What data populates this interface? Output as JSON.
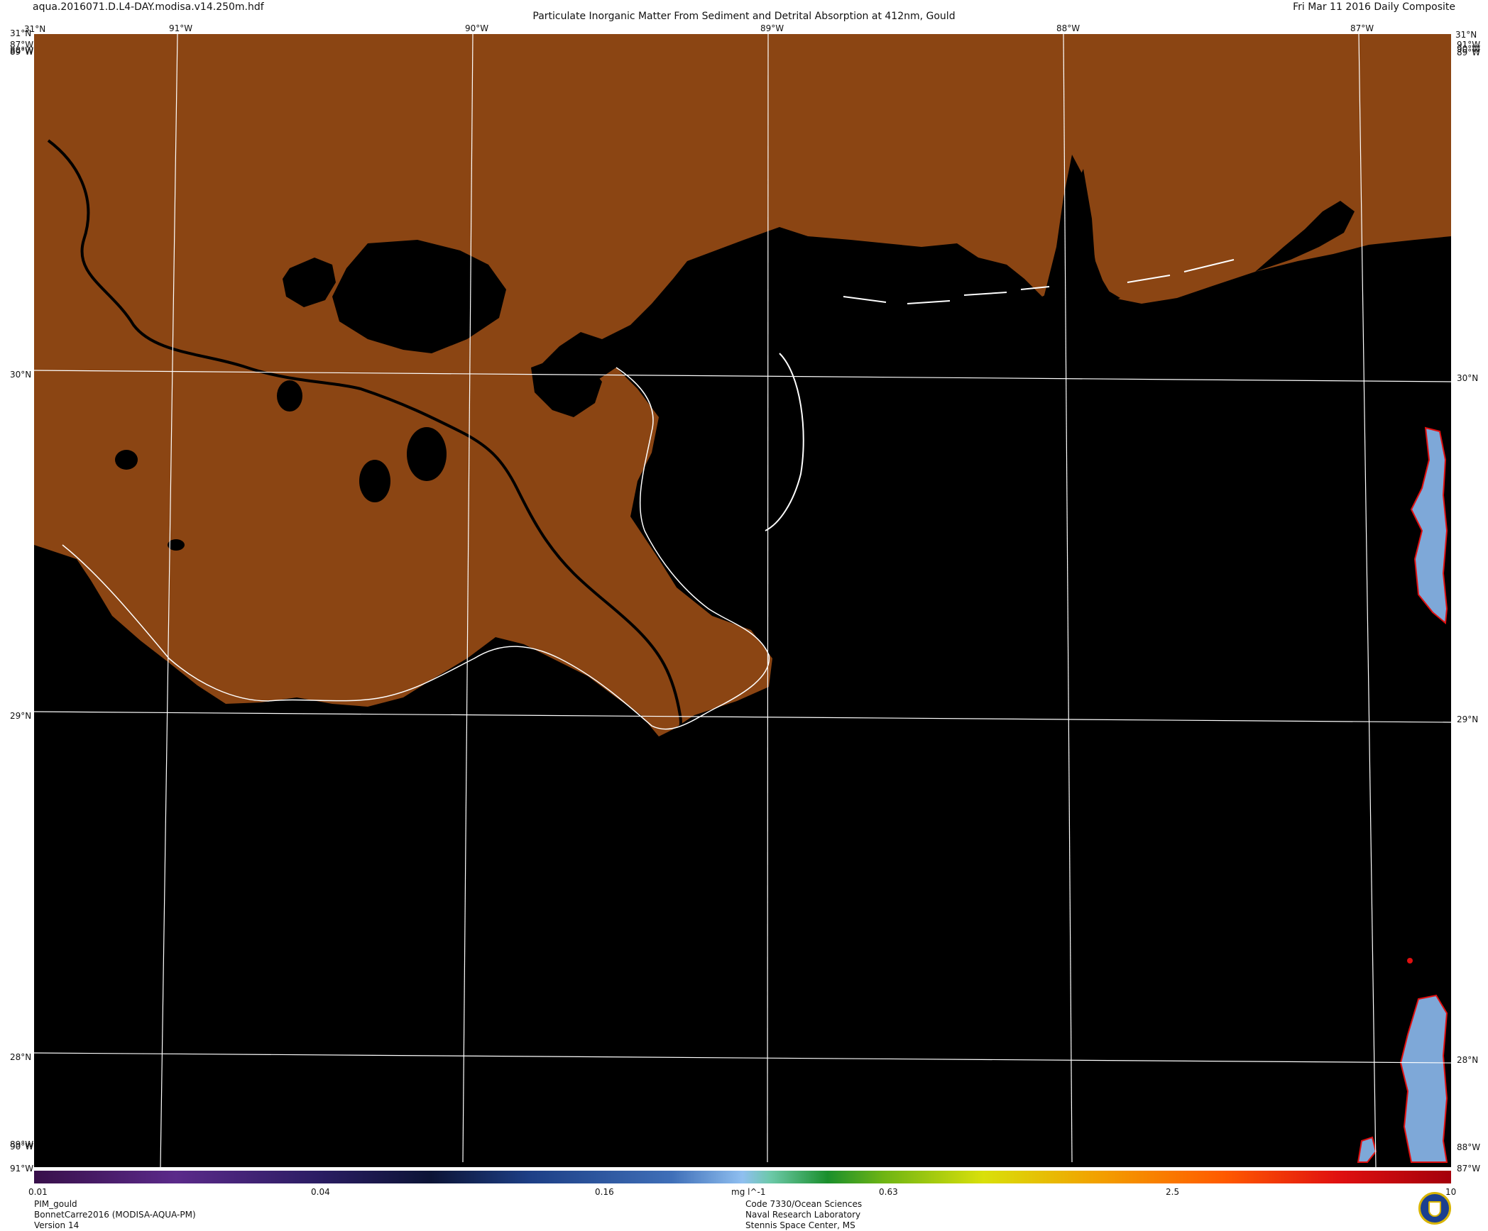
{
  "header": {
    "file": "aqua.2016071.D.L4-DAY.modisa.v14.250m.hdf",
    "title": "Particulate Inorganic Matter From Sediment and Detrital Absorption at 412nm, Gould",
    "date": "Fri Mar 11 2016 Daily Composite"
  },
  "graticule": {
    "top_lon": [
      "91°W",
      "90°W",
      "89°W",
      "88°W",
      "87°W"
    ],
    "lat_left": [
      "31°N",
      "30°N",
      "29°N",
      "28°N"
    ],
    "lat_right": [
      "31°N",
      "30°N",
      "29°N",
      "28°N"
    ],
    "corner_tl": "31°N",
    "corner_tr": "31°N",
    "side_lon_left_top": [
      "87°W",
      "88°W",
      "89°W"
    ],
    "side_lon_right_top": [
      "91°W",
      "90°W",
      "89°W"
    ],
    "side_lon_left_bottom": [
      "89°W",
      "90°W",
      "91°W"
    ],
    "side_lon_right_bottom": [
      "88°W",
      "87°W"
    ]
  },
  "colors": {
    "land": "#8B4513",
    "no_data": "#000000",
    "coastline": "#ffffff",
    "graticule": "#ffffff"
  },
  "colorbar": {
    "ticks": [
      "0.01",
      "0.04",
      "0.16",
      "0.63",
      "2.5",
      "10"
    ],
    "units": "mg l^-1"
  },
  "footer": {
    "left": [
      "PIM_gould",
      "BonnetCarre2016 (MODISA-AQUA-PM)",
      "Version 14"
    ],
    "center": [
      "Code 7330/Ocean Sciences",
      "Naval Research Laboratory",
      "Stennis Space Center, MS"
    ]
  }
}
